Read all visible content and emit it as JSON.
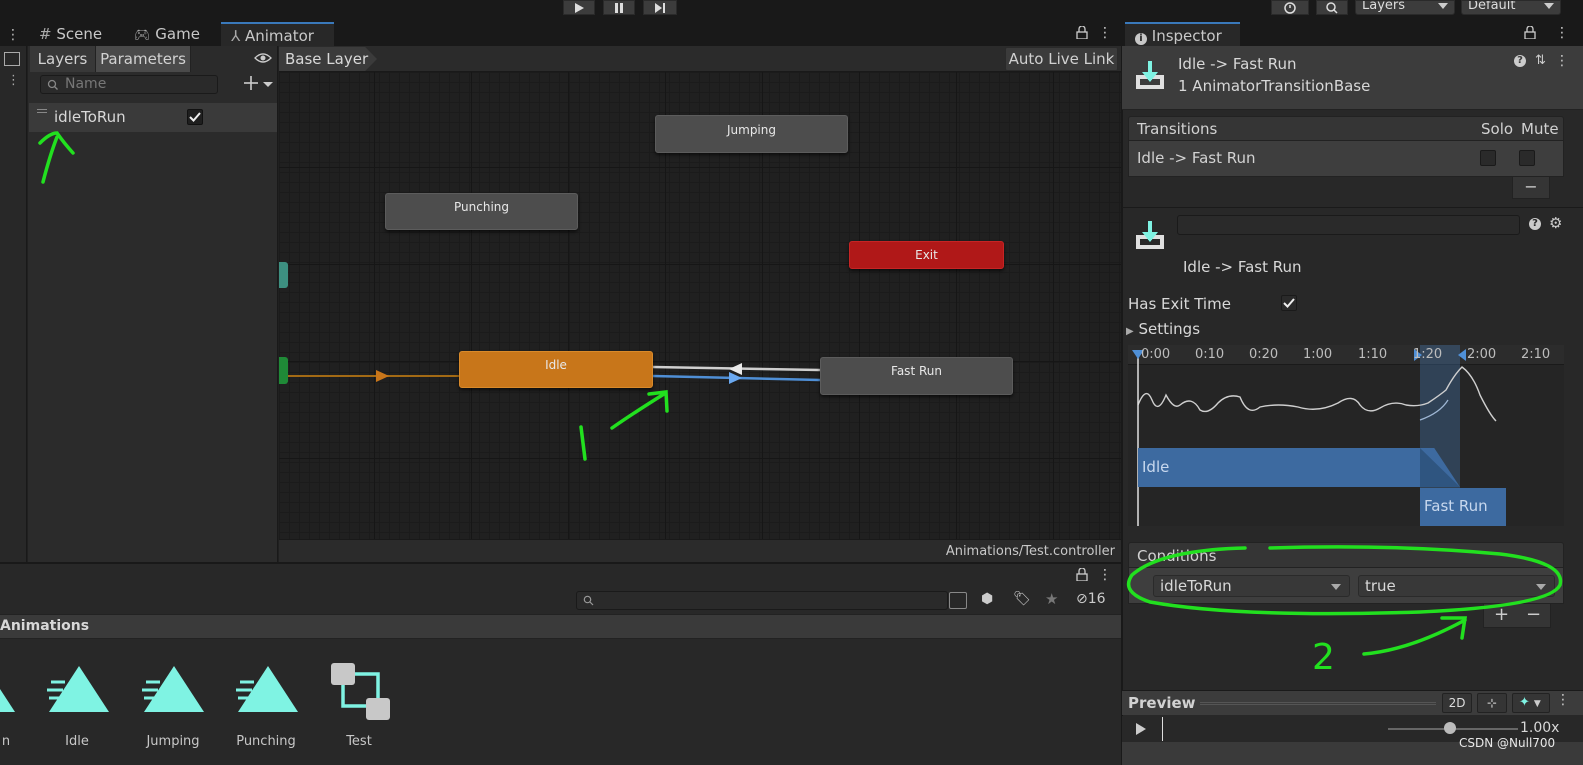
{
  "toolbar": {
    "layers_dropdown": "Layers",
    "layout_dropdown": "Default"
  },
  "tabs": {
    "scene": "Scene",
    "game": "Game",
    "animator": "Animator"
  },
  "animator": {
    "layers_tab": "Layers",
    "parameters_tab": "Parameters",
    "search_placeholder": "Name",
    "breadcrumb": "Base Layer",
    "auto_live_link": "Auto Live Link",
    "footer_path": "Animations/Test.controller",
    "parameter": {
      "name": "idleToRun",
      "checked": true
    },
    "states": {
      "jumping": "Jumping",
      "punching": "Punching",
      "exit": "Exit",
      "idle": "Idle",
      "fast_run": "Fast Run"
    },
    "annotation_1": "1"
  },
  "project": {
    "hidden_count": "16",
    "folder_title": "Animations",
    "assets": [
      {
        "label": "n",
        "icon": "animation-clip-icon"
      },
      {
        "label": "Idle",
        "icon": "animation-clip-icon"
      },
      {
        "label": "Jumping",
        "icon": "animation-clip-icon"
      },
      {
        "label": "Punching",
        "icon": "animation-clip-icon"
      },
      {
        "label": "Test",
        "icon": "animator-controller-icon"
      }
    ]
  },
  "inspector": {
    "tab": "Inspector",
    "header_title": "Idle -> Fast Run",
    "header_subtitle": "1 AnimatorTransitionBase",
    "transitions_header": "Transitions",
    "solo": "Solo",
    "mute": "Mute",
    "transition_row": "Idle -> Fast Run",
    "transition_name": "Idle -> Fast Run",
    "has_exit_time_label": "Has Exit Time",
    "has_exit_time": true,
    "settings_label": "Settings",
    "timeline_ticks": [
      "0:00",
      "0:10",
      "0:20",
      "1:00",
      "1:10",
      "1:20",
      "2:00",
      "2:10"
    ],
    "timeline_idle": "Idle",
    "timeline_fast_run": "Fast Run",
    "conditions_label": "Conditions",
    "condition_param": "idleToRun",
    "condition_value": "true",
    "annotation_2": "2",
    "preview_label": "Preview",
    "preview_2d": "2D",
    "preview_speed": "1.00x"
  },
  "watermark": "CSDN @Null700",
  "colors": {
    "idle_state": "#c8761a",
    "exit_state": "#b01818",
    "transition_selected": "#4f8fd6",
    "annotation": "#22e01f",
    "accent_cyan": "#7ff3e3"
  }
}
